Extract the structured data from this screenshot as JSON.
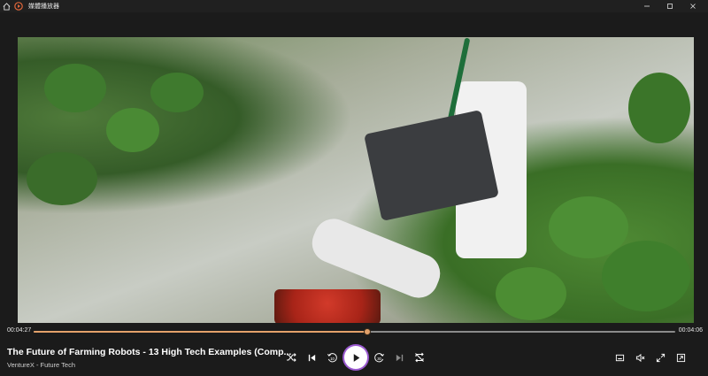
{
  "window": {
    "title": "媒體播放器"
  },
  "player": {
    "current_time": "00:04:27",
    "total_time": "00:04:06",
    "progress_fraction": 0.52
  },
  "media": {
    "title": "The Future of Farming Robots - 13 High Tech Examples (Comp...",
    "subtitle": "VentureX - Future Tech"
  },
  "colors": {
    "accent": "#e3a16a",
    "play_ring": "#9b5ad0",
    "background": "#1b1b1b"
  },
  "icons": [
    "home-icon",
    "app-logo-icon",
    "minimize-icon",
    "maximize-icon",
    "close-icon",
    "shuffle-icon",
    "previous-icon",
    "rewind-10-icon",
    "play-icon",
    "forward-30-icon",
    "next-icon",
    "repeat-off-icon",
    "miniplayer-icon",
    "volume-icon",
    "fullscreen-icon",
    "cast-icon"
  ]
}
